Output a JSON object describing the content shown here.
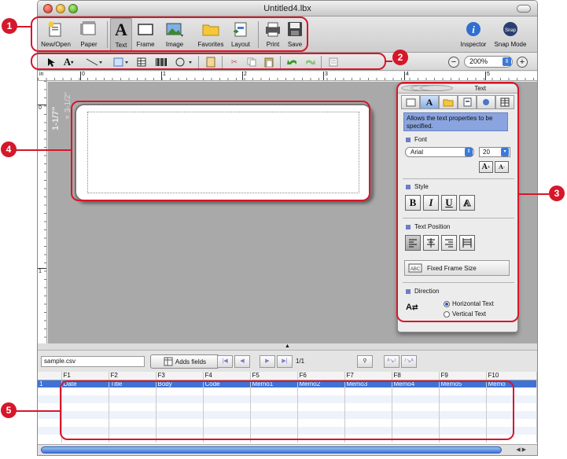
{
  "window": {
    "title": "Untitled4.lbx"
  },
  "toolbar": {
    "buttons": [
      {
        "label": "New/Open"
      },
      {
        "label": "Paper"
      },
      {
        "label": "Text"
      },
      {
        "label": "Frame"
      },
      {
        "label": "Image"
      },
      {
        "label": "Favorites"
      },
      {
        "label": "Layout"
      },
      {
        "label": "Print"
      },
      {
        "label": "Save"
      },
      {
        "label": "Inspector"
      },
      {
        "label": "Snap Mode"
      }
    ]
  },
  "format_bar": {
    "zoom": "200%",
    "text_tool_glyph": "A",
    "zoom_out": "−",
    "zoom_in": "+"
  },
  "ruler": {
    "h_ticks": [
      "in",
      "0",
      "1",
      "2",
      "3",
      "4",
      "5"
    ],
    "v_ticks": [
      "0",
      "1"
    ]
  },
  "canvas": {
    "label_size_text": "1-1/7\"",
    "label_size_text2": "× 3-1/2\""
  },
  "inspector": {
    "title": "Text",
    "description": "Allows the text properties to be specified.",
    "font_section": "Font",
    "font_value": "Arial",
    "size_value": "20",
    "style_section": "Style",
    "style_buttons": [
      "B",
      "I",
      "U",
      "A"
    ],
    "position_section": "Text Position",
    "fixed_frame": "Fixed Frame Size",
    "direction_section": "Direction",
    "horizontal": "Horizontal Text",
    "vertical": "Vertical Text",
    "tab_text_glyph": "A"
  },
  "database": {
    "file": "sample.csv",
    "adds_fields": "Adds fields",
    "page": "1/1",
    "headers": [
      "",
      "F1",
      "F2",
      "F3",
      "F4",
      "F5",
      "F6",
      "F7",
      "F8",
      "F9",
      "F10"
    ],
    "row1": [
      "1",
      "Date",
      "Title",
      "Body",
      "Code",
      "Memo1",
      "Memo2",
      "Memo3",
      "Memo4",
      "Memo5",
      "Memo"
    ]
  },
  "callouts": [
    "1",
    "2",
    "3",
    "4",
    "5"
  ],
  "colors": {
    "callout": "#d6172a",
    "selection": "#3f72d4"
  }
}
